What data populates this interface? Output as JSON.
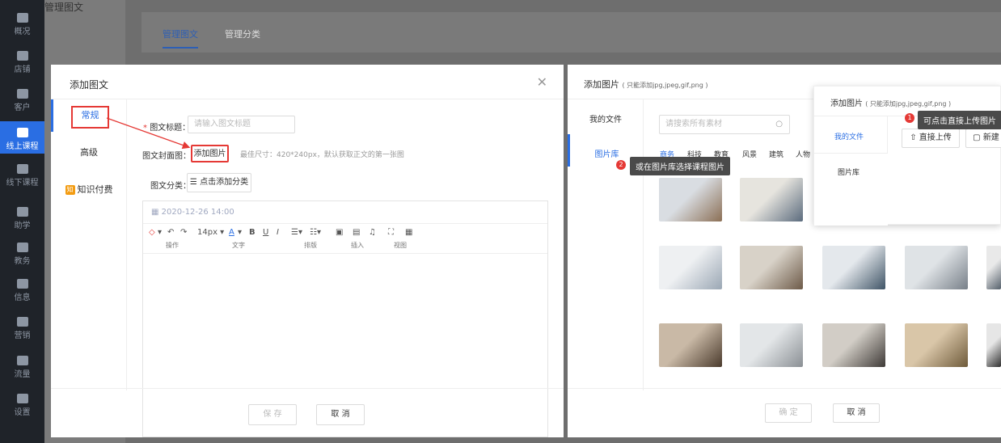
{
  "sidebar": {
    "items": [
      {
        "label": "概况"
      },
      {
        "label": "店铺"
      },
      {
        "label": "客户"
      },
      {
        "label": "线上课程"
      },
      {
        "label": "线下课程"
      },
      {
        "label": "助学"
      },
      {
        "label": "教务"
      },
      {
        "label": "信息"
      },
      {
        "label": "营销"
      },
      {
        "label": "流量"
      },
      {
        "label": "设置"
      }
    ]
  },
  "subnav": {
    "group": "图文",
    "selected": "管理图文"
  },
  "tabs": [
    {
      "label": "管理图文"
    },
    {
      "label": "管理分类"
    }
  ],
  "modal_left": {
    "title": "添加图文",
    "close": "✕",
    "tabs": [
      {
        "label": "常规"
      },
      {
        "label": "高级"
      },
      {
        "label": "知识付费"
      }
    ],
    "form": {
      "title_label": "图文标题：",
      "title_placeholder": "请输入图文标题",
      "cover_label": "图文封面图：",
      "cover_button": "添加图片",
      "cover_hint": "最佳尺寸：420*240px，默认获取正文的第一张图",
      "category_label": "图文分类：",
      "category_button": "点击添加分类"
    },
    "editor": {
      "date": "2020-12-26 14:00",
      "font_size": "14px",
      "group_labels": [
        "操作",
        "文字",
        "排版",
        "插入",
        "视图"
      ]
    },
    "save": "保 存",
    "cancel": "取 消"
  },
  "modal_right": {
    "title": "添加图片",
    "title_note": "( 只能添加jpg,jpeg,gif,png )",
    "side": [
      {
        "label": "我的文件"
      },
      {
        "label": "图片库"
      }
    ],
    "search_placeholder": "请搜索所有素材",
    "categories": [
      "商务",
      "科技",
      "教育",
      "风景",
      "建筑",
      "人物"
    ],
    "confirm": "确 定",
    "cancel": "取 消"
  },
  "popup": {
    "title": "添加图片",
    "title_note": "( 只能添加jpg,jpeg,gif,png )",
    "side": [
      {
        "label": "我的文件"
      },
      {
        "label": "图片库"
      }
    ],
    "upload": "直接上传",
    "new": "新建"
  },
  "annotations": {
    "step1": "可点击直接上传图片",
    "step1_num": "1",
    "step2": "或在图片库选择课程图片",
    "step2_num": "2"
  },
  "colors": {
    "accent": "#2a6ee3",
    "highlight": "#e53935",
    "sidebar": "#1f2329"
  }
}
